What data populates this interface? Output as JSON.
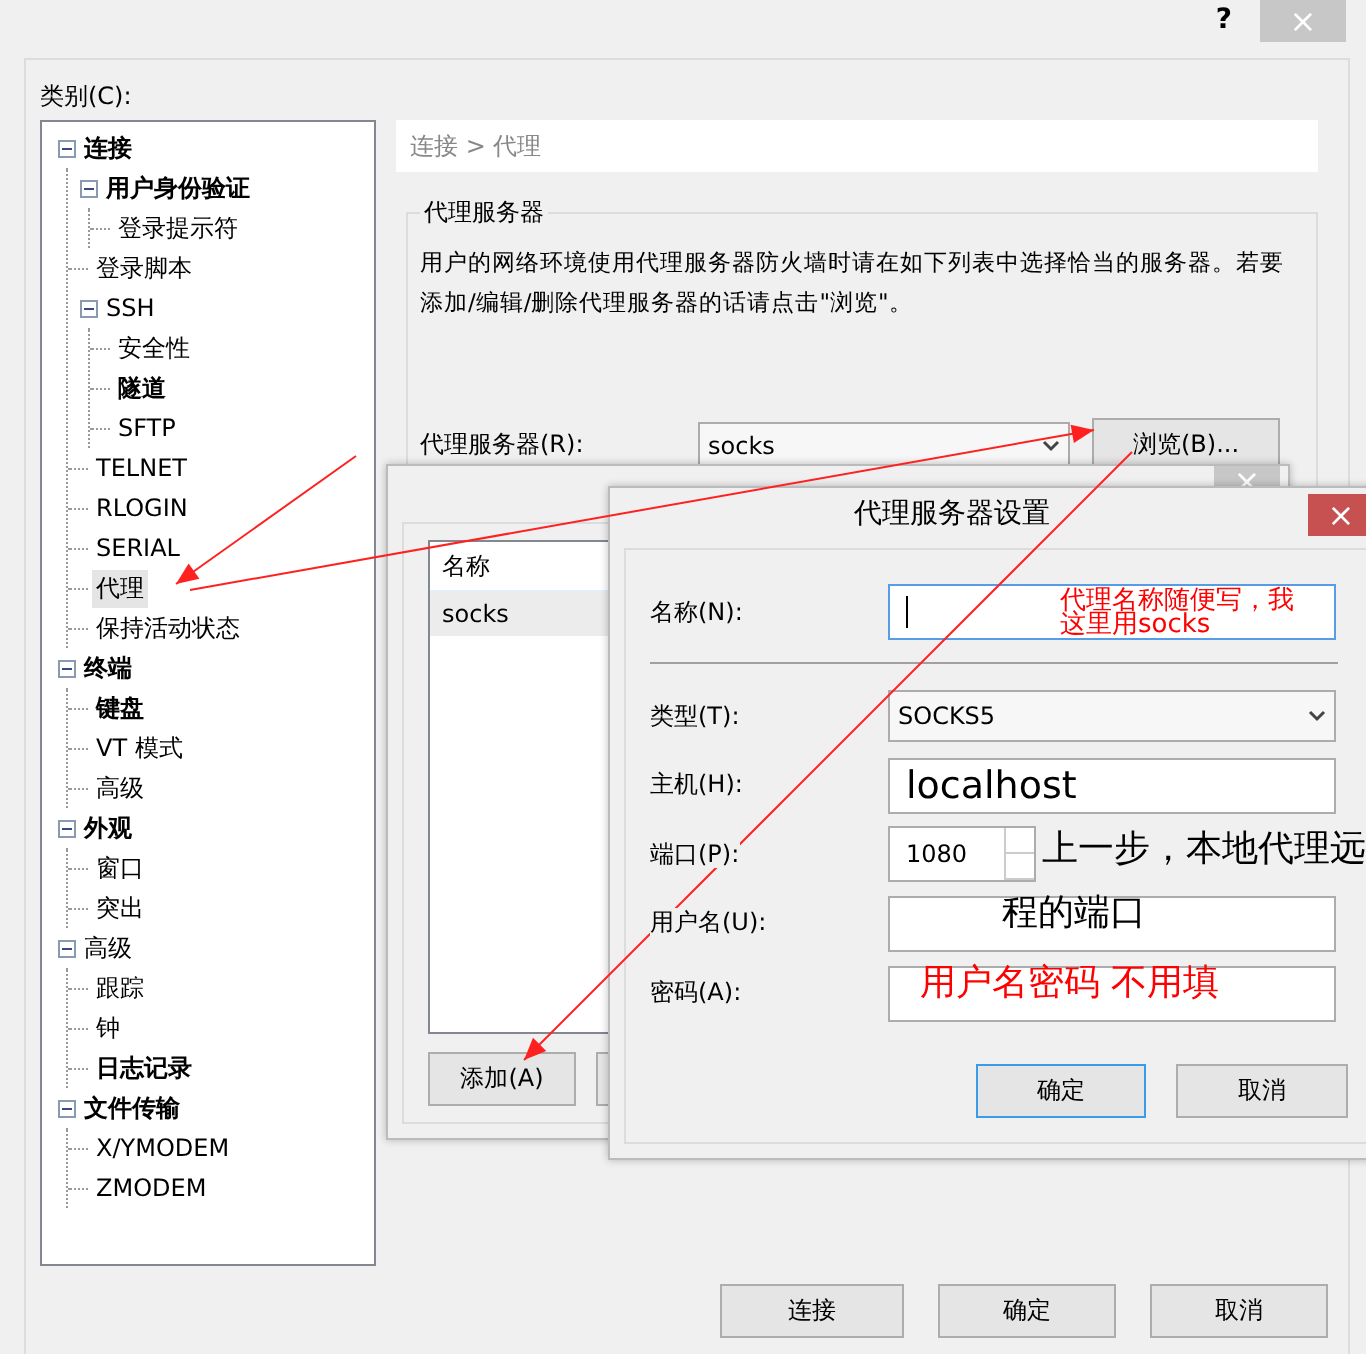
{
  "window": {
    "help": "?",
    "close": "×"
  },
  "category_label": "类别(C):",
  "tree": [
    {
      "label": "连接",
      "bold": true,
      "expanded": true,
      "selected": false,
      "children": [
        {
          "label": "用户身份验证",
          "bold": true,
          "expanded": true,
          "selected": false,
          "children": [
            {
              "label": "登录提示符",
              "bold": false,
              "selected": false
            }
          ]
        },
        {
          "label": "登录脚本",
          "bold": false,
          "selected": false
        },
        {
          "label": "SSH",
          "bold": false,
          "expanded": true,
          "selected": false,
          "children": [
            {
              "label": "安全性",
              "bold": false,
              "selected": false
            },
            {
              "label": "隧道",
              "bold": true,
              "selected": false
            },
            {
              "label": "SFTP",
              "bold": false,
              "selected": false
            }
          ]
        },
        {
          "label": "TELNET",
          "bold": false,
          "selected": false
        },
        {
          "label": "RLOGIN",
          "bold": false,
          "selected": false
        },
        {
          "label": "SERIAL",
          "bold": false,
          "selected": false
        },
        {
          "label": "代理",
          "bold": false,
          "selected": true
        },
        {
          "label": "保持活动状态",
          "bold": false,
          "selected": false
        }
      ]
    },
    {
      "label": "终端",
      "bold": true,
      "expanded": true,
      "selected": false,
      "children": [
        {
          "label": "键盘",
          "bold": true,
          "selected": false
        },
        {
          "label": "VT 模式",
          "bold": false,
          "selected": false
        },
        {
          "label": "高级",
          "bold": false,
          "selected": false
        }
      ]
    },
    {
      "label": "外观",
      "bold": true,
      "expanded": true,
      "selected": false,
      "children": [
        {
          "label": "窗口",
          "bold": false,
          "selected": false
        },
        {
          "label": "突出",
          "bold": false,
          "selected": false
        }
      ]
    },
    {
      "label": "高级",
      "bold": false,
      "expanded": true,
      "selected": false,
      "children": [
        {
          "label": "跟踪",
          "bold": false,
          "selected": false
        },
        {
          "label": "钟",
          "bold": false,
          "selected": false
        },
        {
          "label": "日志记录",
          "bold": true,
          "selected": false
        }
      ]
    },
    {
      "label": "文件传输",
      "bold": true,
      "expanded": true,
      "selected": false,
      "children": [
        {
          "label": "X/YMODEM",
          "bold": false,
          "selected": false
        },
        {
          "label": "ZMODEM",
          "bold": false,
          "selected": false
        }
      ]
    }
  ],
  "breadcrumb": "连接 > 代理",
  "proxy_group": {
    "title": "代理服务器",
    "description": "用户的网络环境使用代理服务器防火墙时请在如下列表中选择恰当的服务器。若要添加/编辑/删除代理服务器的话请点击\"浏览\"。",
    "label": "代理服务器(R):",
    "value": "socks",
    "browse_button": "浏览(B)..."
  },
  "list_dialog": {
    "close": "×",
    "column": "名称",
    "rows": [
      {
        "name": "socks",
        "selected": true
      }
    ],
    "add_button": "添加(A)"
  },
  "settings_dialog": {
    "title": "代理服务器设置",
    "close": "×",
    "fields": [
      {
        "kind": "text",
        "label": "名称(N):",
        "focused": true,
        "annotation": {
          "text": "代理名称随便写，我这里用socks",
          "color": "#ff0000"
        }
      },
      {
        "kind": "select",
        "label": "类型(T):",
        "value": "SOCKS5"
      },
      {
        "kind": "text",
        "label": "主机(H):",
        "value": "localhost",
        "focused": false
      },
      {
        "kind": "spinner",
        "label": "端口(P):",
        "value": "1080",
        "annotation": {
          "text": "上一步，本地代理远",
          "color": "#000000"
        }
      },
      {
        "kind": "text",
        "label": "用户名(U):",
        "focused": false,
        "annotation": {
          "text": "程的端口",
          "color": "#000000"
        }
      },
      {
        "kind": "text",
        "label": "密码(A):",
        "focused": false,
        "annotation": {
          "text": "用户名密码 不用填",
          "color": "#ff0000"
        }
      }
    ],
    "buttons": [
      {
        "label": "确定",
        "default": true
      },
      {
        "label": "取消",
        "default": false
      }
    ]
  },
  "buttons": [
    "连接",
    "确定",
    "取消"
  ]
}
